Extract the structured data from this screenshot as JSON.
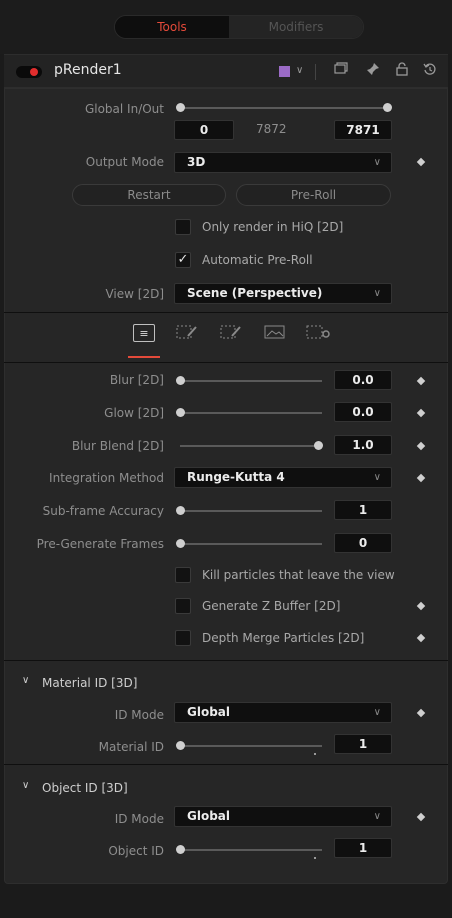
{
  "tabs": {
    "tools": "Tools",
    "modifiers": "Modifiers"
  },
  "node": {
    "title": "pRender1",
    "color": "#9b6bc6"
  },
  "header_icons": [
    "dropdown-chevron-icon",
    "window-icon",
    "pin-icon",
    "lock-icon",
    "reset-icon"
  ],
  "global_inout": {
    "label": "Global In/Out",
    "start": "0",
    "mid": "7872",
    "end": "7871"
  },
  "output_mode": {
    "label": "Output Mode",
    "value": "3D"
  },
  "buttons": {
    "restart": "Restart",
    "preroll": "Pre-Roll"
  },
  "checks": {
    "hiq": {
      "label": "Only render in HiQ [2D]",
      "checked": false
    },
    "auto_preroll": {
      "label": "Automatic Pre-Roll",
      "checked": true
    }
  },
  "view": {
    "label": "View [2D]",
    "value": "Scene (Perspective)"
  },
  "subtabs": [
    "controls-icon",
    "particle-edit-icon",
    "particle-edit-2-icon",
    "image-icon",
    "settings-icon"
  ],
  "controls": {
    "blur": {
      "label": "Blur [2D]",
      "value": "0.0",
      "fraction": 0
    },
    "glow": {
      "label": "Glow [2D]",
      "value": "0.0",
      "fraction": 0
    },
    "blur_blend": {
      "label": "Blur Blend [2D]",
      "value": "1.0",
      "fraction": 1
    },
    "integration": {
      "label": "Integration Method",
      "value": "Runge-Kutta 4"
    },
    "subframe": {
      "label": "Sub-frame Accuracy",
      "value": "1",
      "fraction": 0
    },
    "pregen": {
      "label": "Pre-Generate Frames",
      "value": "0",
      "fraction": 0
    },
    "kill": {
      "label": "Kill particles that leave the view",
      "checked": false
    },
    "zbuffer": {
      "label": "Generate Z Buffer [2D]",
      "checked": false
    },
    "depth_merge": {
      "label": "Depth Merge Particles [2D]",
      "checked": false
    }
  },
  "material": {
    "title": "Material ID [3D]",
    "id_mode_label": "ID Mode",
    "id_mode_value": "Global",
    "id_label": "Material ID",
    "id_value": "1"
  },
  "object": {
    "title": "Object ID [3D]",
    "id_mode_label": "ID Mode",
    "id_mode_value": "Global",
    "id_label": "Object ID",
    "id_value": "1"
  }
}
